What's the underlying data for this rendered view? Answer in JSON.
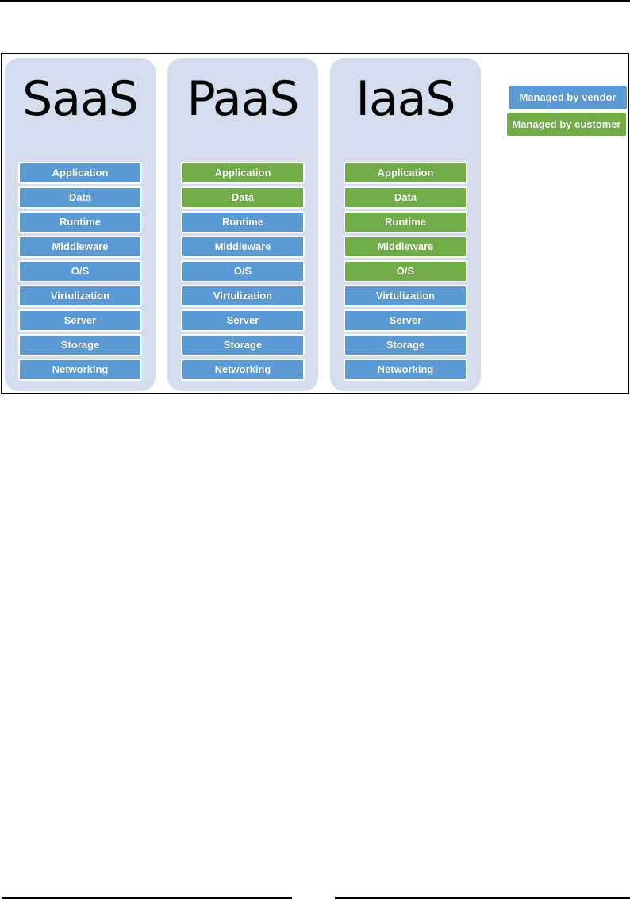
{
  "colors": {
    "vendor": "#5b9bd5",
    "customer": "#70ad47",
    "column_bg": "#d3ddee"
  },
  "legend": {
    "vendor_label": "Managed by vendor",
    "customer_label": "Managed by customer"
  },
  "models": [
    {
      "title": "SaaS",
      "layers": [
        {
          "label": "Application",
          "managed_by": "vendor"
        },
        {
          "label": "Data",
          "managed_by": "vendor"
        },
        {
          "label": "Runtime",
          "managed_by": "vendor"
        },
        {
          "label": "Middleware",
          "managed_by": "vendor"
        },
        {
          "label": "O/S",
          "managed_by": "vendor"
        },
        {
          "label": "Virtulization",
          "managed_by": "vendor"
        },
        {
          "label": "Server",
          "managed_by": "vendor"
        },
        {
          "label": "Storage",
          "managed_by": "vendor"
        },
        {
          "label": "Networking",
          "managed_by": "vendor"
        }
      ]
    },
    {
      "title": "PaaS",
      "layers": [
        {
          "label": "Application",
          "managed_by": "customer"
        },
        {
          "label": "Data",
          "managed_by": "customer"
        },
        {
          "label": "Runtime",
          "managed_by": "vendor"
        },
        {
          "label": "Middleware",
          "managed_by": "vendor"
        },
        {
          "label": "O/S",
          "managed_by": "vendor"
        },
        {
          "label": "Virtulization",
          "managed_by": "vendor"
        },
        {
          "label": "Server",
          "managed_by": "vendor"
        },
        {
          "label": "Storage",
          "managed_by": "vendor"
        },
        {
          "label": "Networking",
          "managed_by": "vendor"
        }
      ]
    },
    {
      "title": "IaaS",
      "layers": [
        {
          "label": "Application",
          "managed_by": "customer"
        },
        {
          "label": "Data",
          "managed_by": "customer"
        },
        {
          "label": "Runtime",
          "managed_by": "customer"
        },
        {
          "label": "Middleware",
          "managed_by": "customer"
        },
        {
          "label": "O/S",
          "managed_by": "customer"
        },
        {
          "label": "Virtulization",
          "managed_by": "vendor"
        },
        {
          "label": "Server",
          "managed_by": "vendor"
        },
        {
          "label": "Storage",
          "managed_by": "vendor"
        },
        {
          "label": "Networking",
          "managed_by": "vendor"
        }
      ]
    }
  ]
}
